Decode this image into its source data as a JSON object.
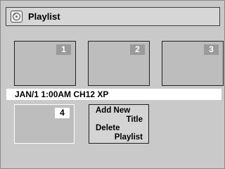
{
  "header": {
    "title": "Playlist",
    "icon": "playlist-icon"
  },
  "titles": [
    {
      "number": "1",
      "selected": false
    },
    {
      "number": "2",
      "selected": false
    },
    {
      "number": "3",
      "selected": false
    },
    {
      "number": "4",
      "selected": true
    }
  ],
  "info": {
    "text": "JAN/1 1:00AM CH12 XP"
  },
  "menu": {
    "add_new_title_line1": "Add New",
    "add_new_title_line2": "Title",
    "delete_playlist_line1": "Delete",
    "delete_playlist_line2": "Playlist"
  }
}
